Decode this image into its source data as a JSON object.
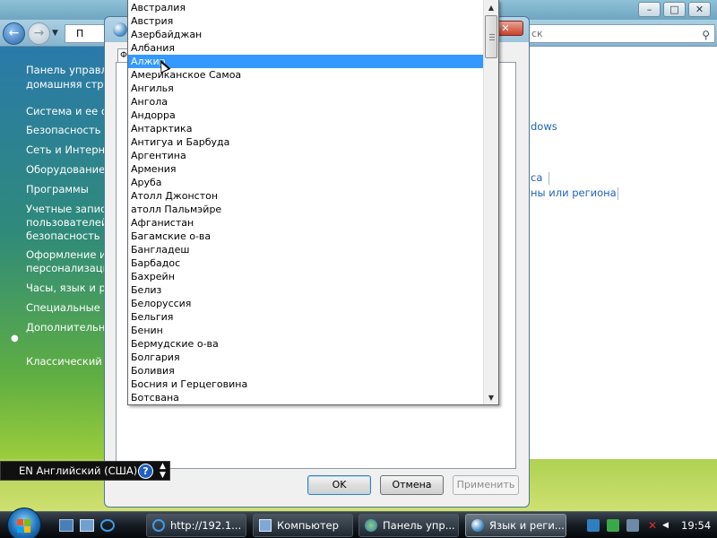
{
  "control_panel": {
    "search_placeholder": "Поиск",
    "search_partial": "ск",
    "address_partial": "П",
    "sidebar": {
      "home_line1": "Панель управле",
      "home_line2": "домашняя стра",
      "items": [
        "Система и ее об",
        "Безопасность",
        "Сеть и Интерне",
        "Оборудование и",
        "Программы",
        "Учетные записи",
        "пользователей",
        "безопасность",
        "Оформление и",
        "персонализаци",
        "Часы, язык и рег",
        "Специальные в",
        "Дополнительны",
        "Классический в"
      ]
    },
    "content_links": {
      "windows": "dows",
      "region_tail": "са",
      "region_name": "ны или региона"
    }
  },
  "dialog": {
    "tab_stub": "Ф",
    "buttons": {
      "ok": "OK",
      "cancel": "Отмена",
      "apply": "Применить"
    },
    "close_symbol": "✕"
  },
  "dropdown": {
    "selected_index": 4,
    "items": [
      "Австралия",
      "Австрия",
      "Азербайджан",
      "Албания",
      "Алжир",
      "Американское Самоа",
      "Ангилья",
      "Ангола",
      "Андорра",
      "Антарктика",
      "Антигуа и Барбуда",
      "Аргентина",
      "Армения",
      "Аруба",
      "Атолл Джонстон",
      "атолл Пальмэйре",
      "Афганистан",
      "Багамские о-ва",
      "Бангладеш",
      "Барбадос",
      "Бахрейн",
      "Белиз",
      "Белоруссия",
      "Бельгия",
      "Бенин",
      "Бермудские о-ва",
      "Болгария",
      "Боливия",
      "Босния и Герцеговина",
      "Ботсвана"
    ]
  },
  "language_bar": {
    "text": "EN Английский (США)",
    "help": "?"
  },
  "taskbar": {
    "tasks": [
      {
        "label": "http://192.1...",
        "icon": "ie-icon"
      },
      {
        "label": "Компьютер",
        "icon": "computer-icon"
      },
      {
        "label": "Панель упр...",
        "icon": "control-panel-icon"
      },
      {
        "label": "Язык и реги...",
        "icon": "globe-icon"
      }
    ],
    "clock": "19:54"
  },
  "colors": {
    "selection": "#3399ff",
    "link": "#1c63b7",
    "taskbar": "#161c22"
  }
}
